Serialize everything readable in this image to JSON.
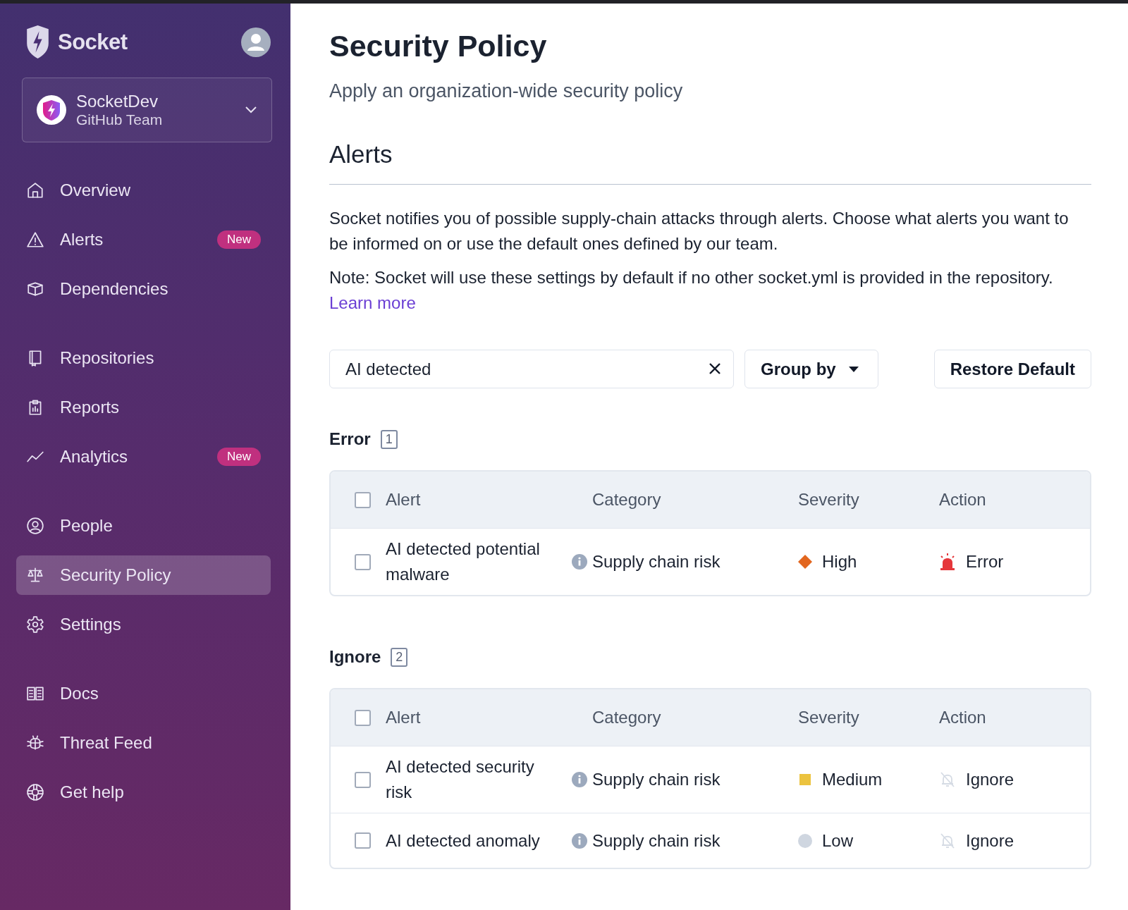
{
  "sidebar": {
    "brand": "Socket",
    "org": {
      "name": "SocketDev",
      "team": "GitHub Team"
    },
    "groups": [
      {
        "items": [
          {
            "label": "Overview",
            "selected": false
          },
          {
            "label": "Alerts",
            "badge": "New",
            "selected": false
          },
          {
            "label": "Dependencies",
            "selected": false
          }
        ]
      },
      {
        "items": [
          {
            "label": "Repositories",
            "selected": false
          },
          {
            "label": "Reports",
            "selected": false
          },
          {
            "label": "Analytics",
            "badge": "New",
            "selected": false
          }
        ]
      },
      {
        "items": [
          {
            "label": "People",
            "selected": false
          },
          {
            "label": "Security Policy",
            "selected": true
          },
          {
            "label": "Settings",
            "selected": false
          }
        ]
      },
      {
        "items": [
          {
            "label": "Docs",
            "selected": false
          },
          {
            "label": "Threat Feed",
            "selected": false
          },
          {
            "label": "Get help",
            "selected": false
          }
        ]
      }
    ]
  },
  "page": {
    "title": "Security Policy",
    "subtitle": "Apply an organization-wide security policy",
    "section": "Alerts",
    "intro": "Socket notifies you of possible supply-chain attacks through alerts. Choose what alerts you want to be informed on or use the default ones defined by our team.",
    "note": "Note: Socket will use these settings by default if no other socket.yml is provided in the repository.",
    "note_link": "Learn more"
  },
  "toolbar": {
    "search": "AI detected",
    "group_by": "Group by",
    "restore": "Restore Default"
  },
  "groups": [
    {
      "title": "Error",
      "count": "1",
      "columns": [
        "Alert",
        "Category",
        "Severity",
        "Action"
      ],
      "all_checked": false,
      "rows": [
        {
          "alert": "AI detected potential malware",
          "checked": false,
          "category": "Supply chain risk",
          "severity": {
            "label": "High",
            "kind": "high",
            "color": "#e2661f"
          },
          "action": {
            "label": "Error",
            "kind": "error"
          }
        }
      ]
    },
    {
      "title": "Ignore",
      "count": "2",
      "columns": [
        "Alert",
        "Category",
        "Severity",
        "Action"
      ],
      "all_checked": false,
      "rows": [
        {
          "alert": "AI detected security risk",
          "checked": false,
          "category": "Supply chain risk",
          "severity": {
            "label": "Medium",
            "kind": "medium",
            "color": "#ecc33f"
          },
          "action": {
            "label": "Ignore",
            "kind": "ignore"
          }
        },
        {
          "alert": "AI detected anomaly",
          "checked": false,
          "category": "Supply chain risk",
          "severity": {
            "label": "Low",
            "kind": "low",
            "color": "#cfd6e0"
          },
          "action": {
            "label": "Ignore",
            "kind": "ignore"
          }
        }
      ]
    }
  ]
}
